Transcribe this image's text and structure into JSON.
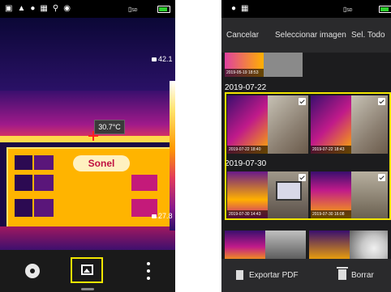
{
  "left": {
    "status_icons": [
      "camera-icon",
      "photo-mode-icon",
      "bulb-icon",
      "grid-icon",
      "zoom-icon",
      "target-icon"
    ],
    "sd_label": "SD",
    "max_temp": "42.1",
    "min_temp": "27.8",
    "spot_temp": "30.7°C",
    "logo_text": "Sonel",
    "battery_level": 0.85
  },
  "right": {
    "sd_label": "SD",
    "header": {
      "cancel": "Cancelar",
      "select_image": "Seleccionar imagen",
      "select_all": "Sel. Todo"
    },
    "groups": [
      {
        "date": "",
        "items": [
          {
            "caption": "2019-05-19 18:53",
            "checked": false
          }
        ]
      },
      {
        "date": "2019-07-22",
        "items": [
          {
            "caption": "2019-07-22 18:40",
            "checked": true
          },
          {
            "caption": "2019-07-22 18:43",
            "checked": true
          }
        ]
      },
      {
        "date": "2019-07-30",
        "items": [
          {
            "caption": "2019-07-30 14:43",
            "checked": true
          },
          {
            "caption": "2019-07-30 16:08",
            "checked": true
          }
        ]
      }
    ],
    "footer": {
      "export_pdf": "Exportar PDF",
      "delete": "Borrar"
    }
  },
  "colors": {
    "accent": "#f2e600",
    "battery": "#2fd12f"
  }
}
